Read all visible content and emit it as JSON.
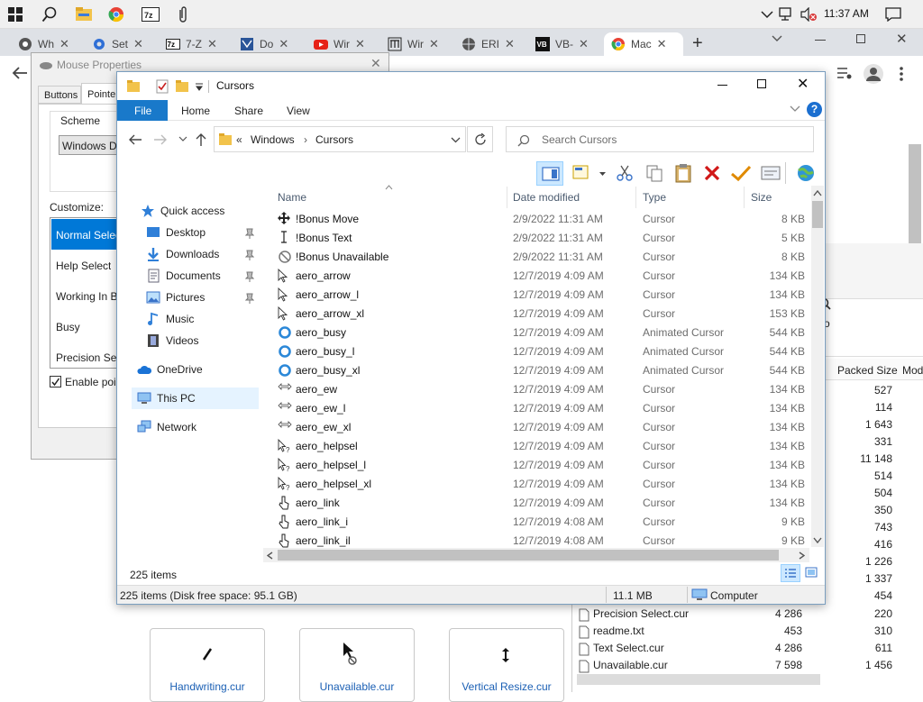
{
  "taskbar": {
    "clock": "11:37 AM"
  },
  "browser": {
    "tabs": [
      {
        "label": "Wh",
        "icon": "chrome-icon"
      },
      {
        "label": "Set",
        "icon": "gear-icon"
      },
      {
        "label": "7-Z",
        "icon": "7zip-icon"
      },
      {
        "label": "Do",
        "icon": "doc-icon"
      },
      {
        "label": "Wir",
        "icon": "youtube-icon"
      },
      {
        "label": "Wir",
        "icon": "wiki-icon"
      },
      {
        "label": "ERI",
        "icon": "globe-icon"
      },
      {
        "label": "VB-",
        "icon": "vb-icon"
      },
      {
        "label": "Mac",
        "icon": "chrome-icon"
      }
    ]
  },
  "mouse_props": {
    "title": "Mouse Properties",
    "tabs": [
      "Buttons",
      "Pointer"
    ],
    "scheme_label": "Scheme",
    "scheme_value": "Windows De",
    "customize_label": "Customize:",
    "list": [
      "Normal Select",
      "Help Select",
      "Working In Ba",
      "Busy",
      "Precision Sele"
    ],
    "enable_label": "Enable point"
  },
  "explorer": {
    "title": "Cursors",
    "ribbon": {
      "file": "File",
      "home": "Home",
      "share": "Share",
      "view": "View"
    },
    "address": {
      "prefix": "«",
      "part1": "Windows",
      "sep": "›",
      "part2": "Cursors"
    },
    "search_placeholder": "Search Cursors",
    "columns": {
      "name": "Name",
      "date": "Date modified",
      "type": "Type",
      "size": "Size"
    },
    "nav": {
      "quick_access": "Quick access",
      "desktop": "Desktop",
      "downloads": "Downloads",
      "documents": "Documents",
      "pictures": "Pictures",
      "music": "Music",
      "videos": "Videos",
      "onedrive": "OneDrive",
      "thispc": "This PC",
      "network": "Network"
    },
    "files": [
      {
        "name": "!Bonus  Move",
        "date": "2/9/2022 11:31 AM",
        "type": "Cursor",
        "size": "8 KB",
        "icon": "move-cursor-icon"
      },
      {
        "name": "!Bonus  Text",
        "date": "2/9/2022 11:31 AM",
        "type": "Cursor",
        "size": "5 KB",
        "icon": "text-cursor-icon"
      },
      {
        "name": "!Bonus  Unavailable",
        "date": "2/9/2022 11:31 AM",
        "type": "Cursor",
        "size": "8 KB",
        "icon": "unavailable-cursor-icon"
      },
      {
        "name": "aero_arrow",
        "date": "12/7/2019 4:09 AM",
        "type": "Cursor",
        "size": "134 KB",
        "icon": "arrow-cursor-icon"
      },
      {
        "name": "aero_arrow_l",
        "date": "12/7/2019 4:09 AM",
        "type": "Cursor",
        "size": "134 KB",
        "icon": "arrow-cursor-icon"
      },
      {
        "name": "aero_arrow_xl",
        "date": "12/7/2019 4:09 AM",
        "type": "Cursor",
        "size": "153 KB",
        "icon": "arrow-cursor-icon"
      },
      {
        "name": "aero_busy",
        "date": "12/7/2019 4:09 AM",
        "type": "Animated Cursor",
        "size": "544 KB",
        "icon": "busy-cursor-icon"
      },
      {
        "name": "aero_busy_l",
        "date": "12/7/2019 4:09 AM",
        "type": "Animated Cursor",
        "size": "544 KB",
        "icon": "busy-cursor-icon"
      },
      {
        "name": "aero_busy_xl",
        "date": "12/7/2019 4:09 AM",
        "type": "Animated Cursor",
        "size": "544 KB",
        "icon": "busy-cursor-icon"
      },
      {
        "name": "aero_ew",
        "date": "12/7/2019 4:09 AM",
        "type": "Cursor",
        "size": "134 KB",
        "icon": "ew-cursor-icon"
      },
      {
        "name": "aero_ew_l",
        "date": "12/7/2019 4:09 AM",
        "type": "Cursor",
        "size": "134 KB",
        "icon": "ew-cursor-icon"
      },
      {
        "name": "aero_ew_xl",
        "date": "12/7/2019 4:09 AM",
        "type": "Cursor",
        "size": "134 KB",
        "icon": "ew-cursor-icon"
      },
      {
        "name": "aero_helpsel",
        "date": "12/7/2019 4:09 AM",
        "type": "Cursor",
        "size": "134 KB",
        "icon": "helpsel-cursor-icon"
      },
      {
        "name": "aero_helpsel_l",
        "date": "12/7/2019 4:09 AM",
        "type": "Cursor",
        "size": "134 KB",
        "icon": "helpsel-cursor-icon"
      },
      {
        "name": "aero_helpsel_xl",
        "date": "12/7/2019 4:09 AM",
        "type": "Cursor",
        "size": "134 KB",
        "icon": "helpsel-cursor-icon"
      },
      {
        "name": "aero_link",
        "date": "12/7/2019 4:09 AM",
        "type": "Cursor",
        "size": "134 KB",
        "icon": "link-cursor-icon"
      },
      {
        "name": "aero_link_i",
        "date": "12/7/2019 4:08 AM",
        "type": "Cursor",
        "size": "9 KB",
        "icon": "link-cursor-icon"
      },
      {
        "name": "aero_link_il",
        "date": "12/7/2019 4:08 AM",
        "type": "Cursor",
        "size": "9 KB",
        "icon": "link-cursor-icon"
      }
    ],
    "status_items": "225 items",
    "status_detail": "225 items (Disk free space: 95.1 GB)",
    "status_size": "11.1 MB",
    "status_location": "Computer"
  },
  "zip": {
    "col_packed": "Packed Size",
    "col_mod": "Mod",
    "tool_label": "o",
    "packed": [
      "527",
      "114",
      "1 643",
      "331",
      "11 148",
      "514",
      "504",
      "350",
      "743",
      "416",
      "1 226",
      "1 337",
      "454"
    ],
    "rows": [
      {
        "name": "Precision Select.cur",
        "size": "4 286",
        "packed": "220"
      },
      {
        "name": "readme.txt",
        "size": "453",
        "packed": "310"
      },
      {
        "name": "Text Select.cur",
        "size": "4 286",
        "packed": "611"
      },
      {
        "name": "Unavailable.cur",
        "size": "7 598",
        "packed": "1 456"
      }
    ]
  },
  "thumbs": [
    "Handwriting.cur",
    "Unavailable.cur",
    "Vertical Resize.cur"
  ]
}
